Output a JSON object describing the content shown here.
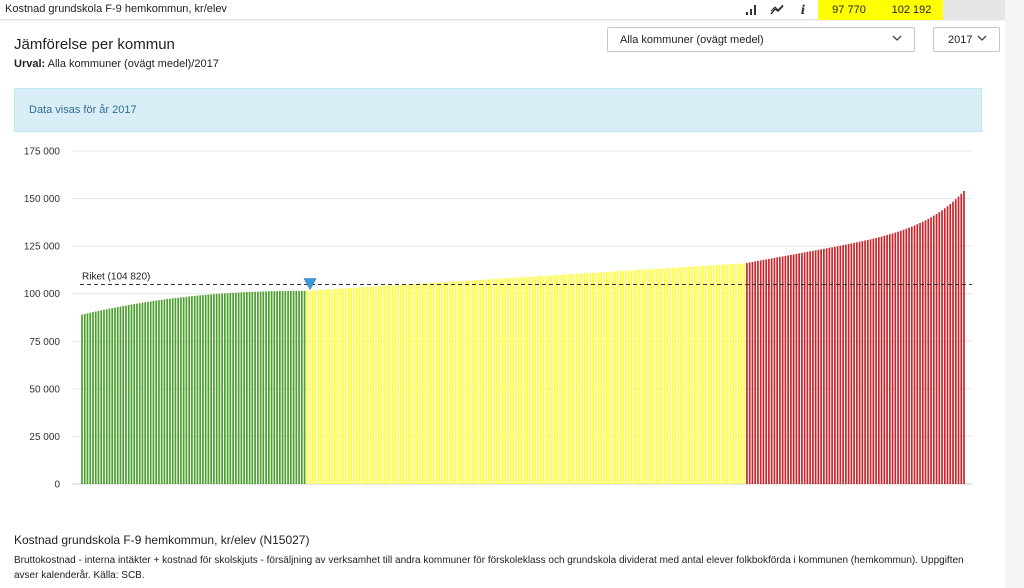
{
  "topbar": {
    "title": "Kostnad grundskola F-9 hemkommun, kr/elev",
    "value_low": "97 770",
    "value_high": "102 192",
    "info_glyph": "i",
    "icons": [
      "bar-chart-icon",
      "trend-icon",
      "info-icon"
    ]
  },
  "heading": "Jämförelse per kommun",
  "urval": {
    "label": "Urval:",
    "value": "Alla kommuner (ovägt medel)/2017"
  },
  "controls": {
    "municipality_selected": "Alla kommuner (ovägt medel)",
    "year_selected": "2017"
  },
  "info_message": "Data visas för år 2017",
  "colors": {
    "green": "#4aa02c",
    "yellow": "#ffff3a",
    "red": "#c8262c",
    "marker": "#3a9ad9",
    "reference_line": "#333333"
  },
  "chart_data": {
    "type": "bar",
    "ylim": [
      0,
      175000
    ],
    "yticks": [
      0,
      25000,
      50000,
      75000,
      100000,
      125000,
      150000,
      175000
    ],
    "ytick_labels": [
      "0",
      "25 000",
      "50 000",
      "75 000",
      "100 000",
      "125 000",
      "150 000",
      "175 000"
    ],
    "grid": true,
    "reference": {
      "label": "Riket (104 820)",
      "value": 104820
    },
    "marker_position_index": 83,
    "groups": [
      {
        "color": "green",
        "count": 82,
        "start": 89000,
        "end": 101500
      },
      {
        "color": "yellow",
        "count": 160,
        "start": 101600,
        "end": 116000
      },
      {
        "color": "red",
        "count": 80,
        "start": 116200,
        "end": 154000
      }
    ]
  },
  "description": {
    "title": "Kostnad grundskola F-9 hemkommun, kr/elev (N15027)",
    "text": "Bruttokostnad - interna intäkter + kostnad för skolskjuts - försäljning av verksamhet till andra kommuner för förskoleklass och grundskola dividerat med antal elever folkbokförda i kommunen (hemkommun). Uppgiften avser kalenderår. Källa: SCB."
  }
}
